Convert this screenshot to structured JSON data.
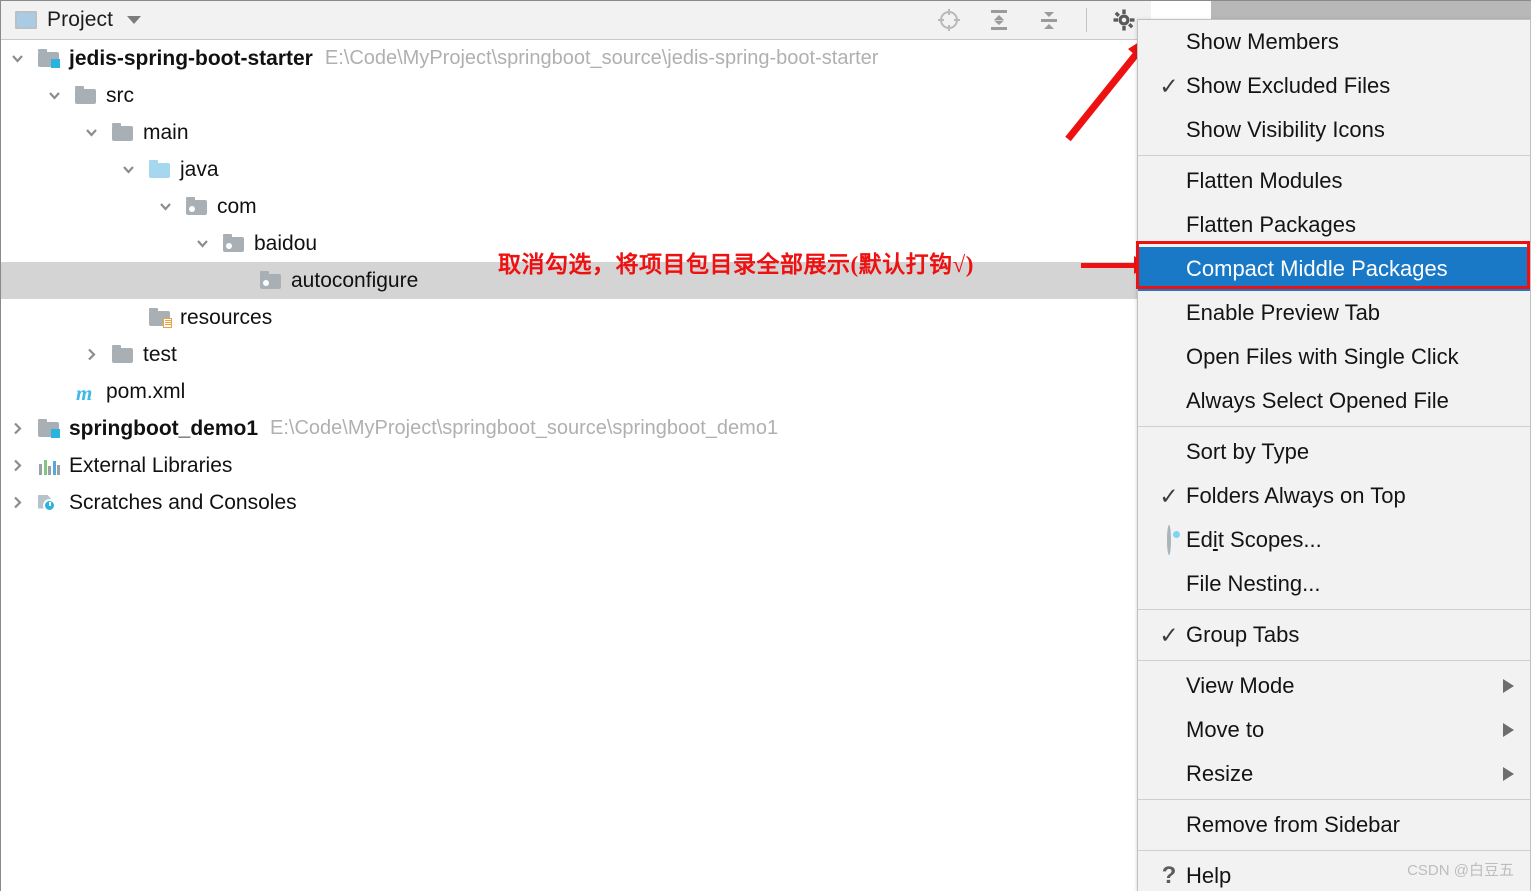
{
  "toolbar": {
    "title": "Project",
    "dropdown_icon": "chevron-down-icon",
    "icons": [
      {
        "name": "locate-file-icon",
        "label": "Select Opened File"
      },
      {
        "name": "expand-all-icon",
        "label": "Expand All"
      },
      {
        "name": "collapse-all-icon",
        "label": "Collapse All"
      },
      {
        "name": "gear-icon",
        "label": "Options"
      }
    ]
  },
  "tree": {
    "nodes": [
      {
        "label": "jedis-spring-boot-starter",
        "path": "E:\\Code\\MyProject\\springboot_source\\jedis-spring-boot-starter",
        "icon": "module-folder-icon",
        "twisty": "expanded",
        "depth": 0,
        "bold": true,
        "selected": false
      },
      {
        "label": "src",
        "path": "",
        "icon": "folder-icon",
        "twisty": "expanded",
        "depth": 1,
        "bold": false,
        "selected": false
      },
      {
        "label": "main",
        "path": "",
        "icon": "folder-icon",
        "twisty": "expanded",
        "depth": 2,
        "bold": false,
        "selected": false
      },
      {
        "label": "java",
        "path": "",
        "icon": "source-root-folder-icon",
        "twisty": "expanded",
        "depth": 3,
        "bold": false,
        "selected": false
      },
      {
        "label": "com",
        "path": "",
        "icon": "package-folder-icon",
        "twisty": "expanded",
        "depth": 4,
        "bold": false,
        "selected": false
      },
      {
        "label": "baidou",
        "path": "",
        "icon": "package-folder-icon",
        "twisty": "expanded",
        "depth": 5,
        "bold": false,
        "selected": false
      },
      {
        "label": "autoconfigure",
        "path": "",
        "icon": "package-folder-icon",
        "twisty": "none",
        "depth": 6,
        "bold": false,
        "selected": true
      },
      {
        "label": "resources",
        "path": "",
        "icon": "resources-folder-icon",
        "twisty": "none",
        "depth": 3,
        "bold": false,
        "selected": false
      },
      {
        "label": "test",
        "path": "",
        "icon": "folder-icon",
        "twisty": "collapsed",
        "depth": 2,
        "bold": false,
        "selected": false
      },
      {
        "label": "pom.xml",
        "path": "",
        "icon": "maven-file-icon",
        "twisty": "none",
        "depth": 1,
        "bold": false,
        "selected": false
      },
      {
        "label": "springboot_demo1",
        "path": "E:\\Code\\MyProject\\springboot_source\\springboot_demo1",
        "icon": "module-folder-icon",
        "twisty": "collapsed",
        "depth": 0,
        "bold": true,
        "selected": false
      },
      {
        "label": "External Libraries",
        "path": "",
        "icon": "external-libraries-icon",
        "twisty": "collapsed",
        "depth": 0,
        "bold": false,
        "selected": false
      },
      {
        "label": "Scratches and Consoles",
        "path": "",
        "icon": "scratches-icon",
        "twisty": "collapsed",
        "depth": 0,
        "bold": false,
        "selected": false
      }
    ]
  },
  "annotation": {
    "text": "取消勾选，将项目包目录全部展示(默认打钩√)",
    "color": "#ee1111"
  },
  "menu": {
    "groups": [
      {
        "items": [
          {
            "label": "Show Members",
            "check": "",
            "icon": "",
            "submenu": false,
            "highlight": false
          },
          {
            "label": "Show Excluded Files",
            "check": "✓",
            "icon": "check-icon",
            "submenu": false,
            "highlight": false
          },
          {
            "label": "Show Visibility Icons",
            "check": "",
            "icon": "",
            "submenu": false,
            "highlight": false
          }
        ]
      },
      {
        "items": [
          {
            "label": "Flatten Modules",
            "check": "",
            "icon": "",
            "submenu": false,
            "highlight": false
          },
          {
            "label": "Flatten Packages",
            "check": "",
            "icon": "",
            "submenu": false,
            "highlight": false
          },
          {
            "label": "Compact Middle Packages",
            "check": "",
            "icon": "",
            "submenu": false,
            "highlight": true
          },
          {
            "label": "Enable Preview Tab",
            "check": "",
            "icon": "",
            "submenu": false,
            "highlight": false
          },
          {
            "label": "Open Files with Single Click",
            "check": "",
            "icon": "",
            "submenu": false,
            "highlight": false
          },
          {
            "label": "Always Select Opened File",
            "check": "",
            "icon": "",
            "submenu": false,
            "highlight": false
          }
        ]
      },
      {
        "items": [
          {
            "label": "Sort by Type",
            "check": "",
            "icon": "",
            "submenu": false,
            "highlight": false
          },
          {
            "label": "Folders Always on Top",
            "check": "✓",
            "icon": "check-icon",
            "submenu": false,
            "highlight": false
          },
          {
            "label": "Edit Scopes...",
            "check": "",
            "icon": "radio-icon",
            "submenu": false,
            "highlight": false
          },
          {
            "label": "File Nesting...",
            "check": "",
            "icon": "",
            "submenu": false,
            "highlight": false
          }
        ]
      },
      {
        "items": [
          {
            "label": "Group Tabs",
            "check": "✓",
            "icon": "check-icon",
            "submenu": false,
            "highlight": false
          }
        ]
      },
      {
        "items": [
          {
            "label": "View Mode",
            "check": "",
            "icon": "",
            "submenu": true,
            "highlight": false
          },
          {
            "label": "Move to",
            "check": "",
            "icon": "",
            "submenu": true,
            "highlight": false
          },
          {
            "label": "Resize",
            "check": "",
            "icon": "",
            "submenu": true,
            "highlight": false
          }
        ]
      },
      {
        "items": [
          {
            "label": "Remove from Sidebar",
            "check": "",
            "icon": "",
            "submenu": false,
            "highlight": false
          }
        ]
      },
      {
        "items": [
          {
            "label": "Help",
            "check": "?",
            "icon": "help-icon",
            "submenu": false,
            "highlight": false
          }
        ]
      }
    ],
    "highlight_color": "#1a79c7"
  },
  "watermark": "CSDN @白豆五"
}
